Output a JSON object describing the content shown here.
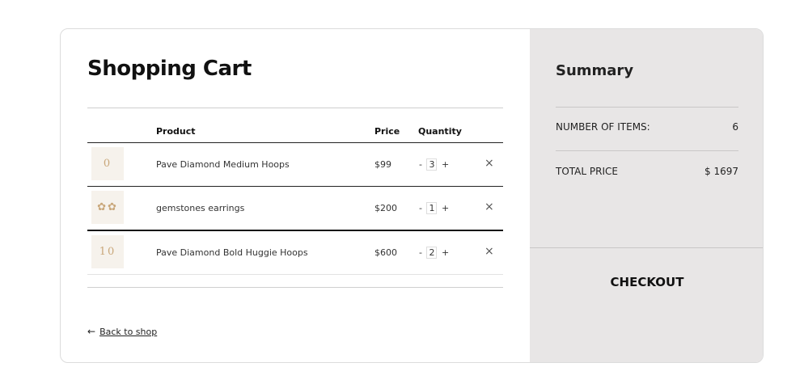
{
  "cart": {
    "title": "Shopping Cart",
    "columns": {
      "product": "Product",
      "price": "Price",
      "quantity": "Quantity"
    },
    "items": [
      {
        "thumb": "0",
        "name": "Pave Diamond Medium Hoops",
        "price": "$99",
        "minus": "-",
        "qty": "3",
        "plus": "+",
        "remove": "×"
      },
      {
        "thumb": "✿✿",
        "name": "gemstones earrings",
        "price": "$200",
        "minus": "-",
        "qty": "1",
        "plus": "+",
        "remove": "×"
      },
      {
        "thumb": "10",
        "name": "Pave Diamond Bold Huggie Hoops",
        "price": "$600",
        "minus": "-",
        "qty": "2",
        "plus": "+",
        "remove": "×"
      }
    ],
    "back_arrow": "←",
    "back_label": "Back to shop"
  },
  "summary": {
    "title": "Summary",
    "items_label": "NUMBER OF ITEMS:",
    "items_value": "6",
    "total_label": "TOTAL PRICE",
    "total_value": "$ 1697",
    "checkout_label": "CHECKOUT"
  }
}
